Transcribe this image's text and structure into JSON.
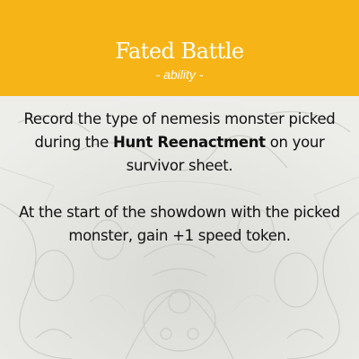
{
  "card": {
    "title": "Fated Battle",
    "subtitle": "- ability -",
    "paragraph1": {
      "before": "Record the type of nemesis monster picked during the ",
      "keyword": "Hunt Reenactment",
      "after": " on your survivor sheet."
    },
    "paragraph2": "At the start of the showdown with the picked monster, gain +1 speed token."
  },
  "colors": {
    "header": "#f7b416",
    "header_text": "#ffffff",
    "background": "#ebebe8",
    "body_text": "#111111"
  }
}
